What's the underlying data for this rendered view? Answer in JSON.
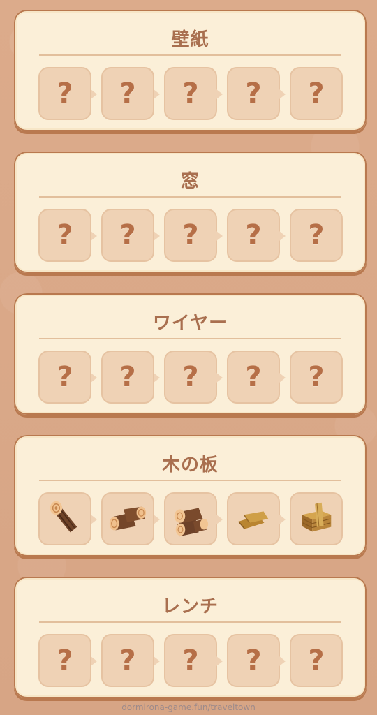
{
  "categories": [
    {
      "title": "壁紙",
      "items": [
        "?",
        "?",
        "?",
        "?",
        "?"
      ]
    },
    {
      "title": "窓",
      "items": [
        "?",
        "?",
        "?",
        "?",
        "?"
      ]
    },
    {
      "title": "ワイヤー",
      "items": [
        "?",
        "?",
        "?",
        "?",
        "?"
      ]
    },
    {
      "title": "木の板",
      "items": [
        "log-icon",
        "log-pair-icon",
        "log-stack-icon",
        "plank-pair-icon",
        "plank-stack-icon"
      ]
    },
    {
      "title": "レンチ",
      "items": [
        "?",
        "?",
        "?",
        "?",
        "?"
      ]
    }
  ],
  "footer": {
    "credit": "dormirona-game.fun/traveltown"
  },
  "colors": {
    "background": "#d9a98a",
    "card": "#fbefd8",
    "slot": "#efd2b5",
    "title": "#a96f4f",
    "question": "#b66f47"
  }
}
